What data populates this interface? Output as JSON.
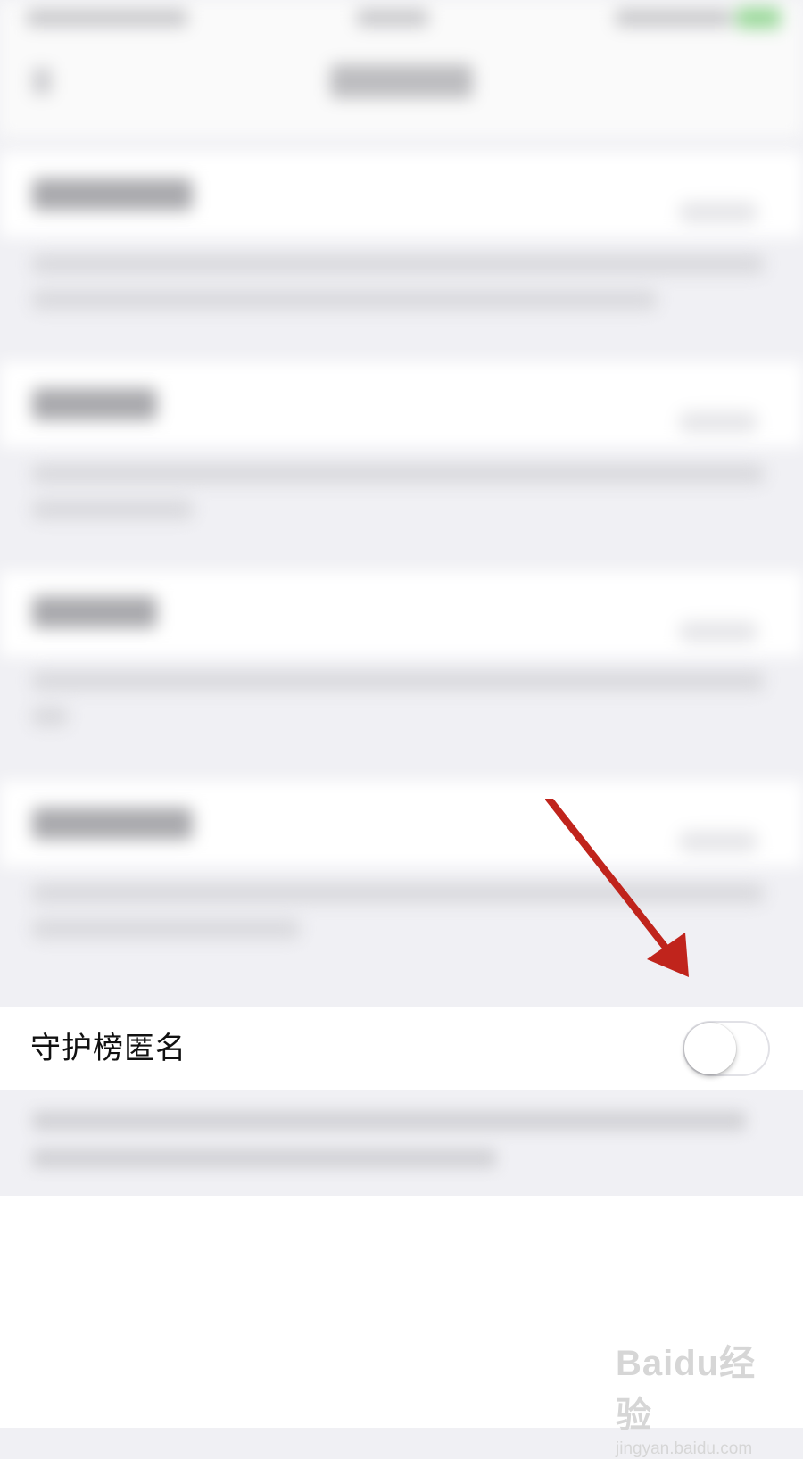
{
  "setting": {
    "label": "守护榜匿名",
    "enabled": false
  },
  "watermark": {
    "logo": "Baidu经验",
    "url": "jingyan.baidu.com"
  },
  "colors": {
    "annotation_arrow": "#c0241c",
    "toggle_off_track": "#ffffff",
    "page_background": "#f0f0f4"
  }
}
